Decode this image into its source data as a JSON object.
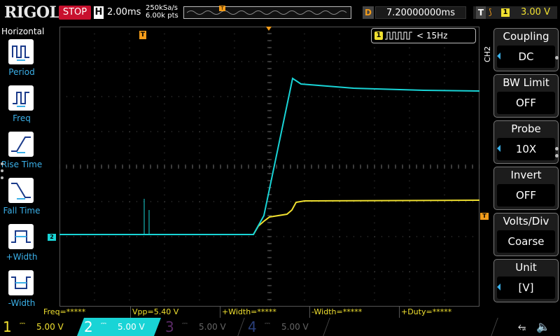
{
  "header": {
    "brand": "RIGOL",
    "run_status": "STOP",
    "timebase_badge": "H",
    "timebase": "2.00ms",
    "sample_rate": "250kSa/s",
    "memory_depth": "6.00k pts",
    "delay_badge": "D",
    "delay": "7.20000000ms",
    "trigger_badge": "T",
    "trigger_source": "1",
    "trigger_level": "3.00 V"
  },
  "left_panel": {
    "title": "Horizontal",
    "items": [
      {
        "label": "Period",
        "icon": "period-icon"
      },
      {
        "label": "Freq",
        "icon": "frequency-icon"
      },
      {
        "label": "Rise Time",
        "icon": "rise-time-icon"
      },
      {
        "label": "Fall Time",
        "icon": "fall-time-icon"
      },
      {
        "label": "+Width",
        "icon": "positive-width-icon"
      },
      {
        "label": "-Width",
        "icon": "negative-width-icon"
      }
    ]
  },
  "display": {
    "trigger_marker": "T",
    "ch2_ref_marker": "2",
    "trigger_level_marker": "T",
    "freq_counter": {
      "channel": "1",
      "value": "< 15Hz"
    }
  },
  "right_panel": {
    "channel_tab": "CH2",
    "menu": [
      {
        "title": "Coupling",
        "value": "DC"
      },
      {
        "title": "BW Limit",
        "value": "OFF"
      },
      {
        "title": "Probe",
        "value": "10X"
      },
      {
        "title": "Invert",
        "value": "OFF"
      },
      {
        "title": "Volts/Div",
        "value": "Coarse"
      },
      {
        "title": "Unit",
        "value": "[V]"
      }
    ]
  },
  "measurements": {
    "freq": "Freq=*****",
    "vpp": "Vpp=5.40 V",
    "pos_width": "+Width=*****",
    "neg_width": "-Width=*****",
    "pos_duty": "+Duty=*****"
  },
  "channels": [
    {
      "num": "1",
      "scale": "5.00 V",
      "color": "#f0e030",
      "active": true
    },
    {
      "num": "2",
      "scale": "5.00 V",
      "color": "#19d4d6",
      "active": true,
      "selected": true
    },
    {
      "num": "3",
      "scale": "5.00 V",
      "color": "#c04bd6",
      "active": false
    },
    {
      "num": "4",
      "scale": "5.00 V",
      "color": "#3b6fe0",
      "active": false
    }
  ],
  "colors": {
    "ch1": "#f0e030",
    "ch2": "#19d4d6",
    "trigger": "#f39c1a",
    "accent": "#3bb0e8",
    "stop": "#c8102e"
  }
}
